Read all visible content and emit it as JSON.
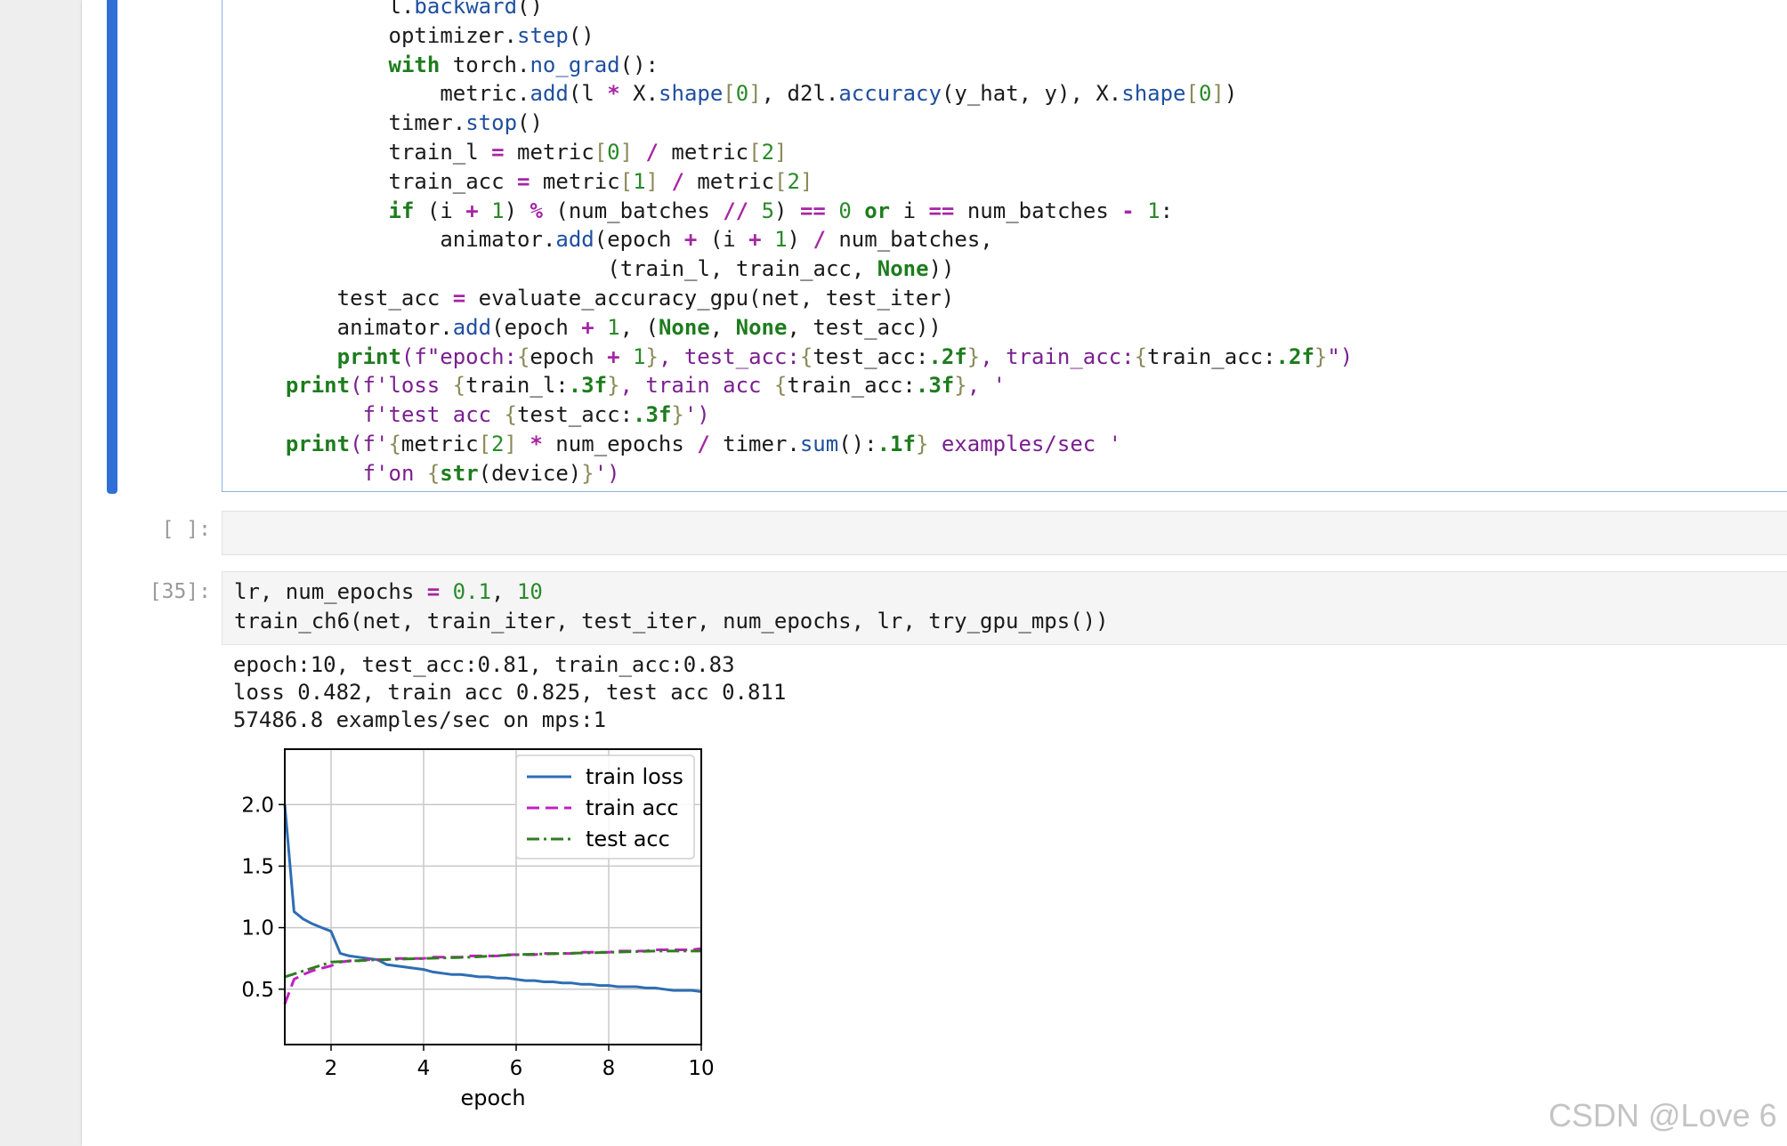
{
  "cell1": {
    "lines": [
      {
        "i": 12,
        "t": [
          [
            "l.",
            "n"
          ],
          [
            "backward",
            "fn"
          ],
          [
            "()",
            "n"
          ]
        ]
      },
      {
        "i": 12,
        "t": [
          [
            "optimizer.",
            "n"
          ],
          [
            "step",
            "fn"
          ],
          [
            "()",
            "n"
          ]
        ]
      },
      {
        "i": 12,
        "t": [
          [
            "with",
            "kw"
          ],
          [
            " torch.",
            "n"
          ],
          [
            "no_grad",
            "fn"
          ],
          [
            "():",
            "n"
          ]
        ]
      },
      {
        "i": 16,
        "t": [
          [
            "metric.",
            "n"
          ],
          [
            "add",
            "fn"
          ],
          [
            "(l ",
            "n"
          ],
          [
            "*",
            "op"
          ],
          [
            " X.",
            "n"
          ],
          [
            "shape",
            "fn"
          ],
          [
            "[",
            "br"
          ],
          [
            "0",
            "nm"
          ],
          [
            "]",
            "br"
          ],
          [
            ", d2l.",
            "n"
          ],
          [
            "accuracy",
            "fn"
          ],
          [
            "(y_hat, y), X.",
            "n"
          ],
          [
            "shape",
            "fn"
          ],
          [
            "[",
            "br"
          ],
          [
            "0",
            "nm"
          ],
          [
            "]",
            "br"
          ],
          [
            ")",
            "n"
          ]
        ]
      },
      {
        "i": 12,
        "t": [
          [
            "timer.",
            "n"
          ],
          [
            "stop",
            "fn"
          ],
          [
            "()",
            "n"
          ]
        ]
      },
      {
        "i": 12,
        "t": [
          [
            "train_l ",
            "n"
          ],
          [
            "=",
            "op"
          ],
          [
            " metric",
            "n"
          ],
          [
            "[",
            "br"
          ],
          [
            "0",
            "nm"
          ],
          [
            "]",
            "br"
          ],
          [
            " ",
            "n"
          ],
          [
            "/",
            "op"
          ],
          [
            " metric",
            "n"
          ],
          [
            "[",
            "br"
          ],
          [
            "2",
            "nm"
          ],
          [
            "]",
            "br"
          ]
        ]
      },
      {
        "i": 12,
        "t": [
          [
            "train_acc ",
            "n"
          ],
          [
            "=",
            "op"
          ],
          [
            " metric",
            "n"
          ],
          [
            "[",
            "br"
          ],
          [
            "1",
            "nm"
          ],
          [
            "]",
            "br"
          ],
          [
            " ",
            "n"
          ],
          [
            "/",
            "op"
          ],
          [
            " metric",
            "n"
          ],
          [
            "[",
            "br"
          ],
          [
            "2",
            "nm"
          ],
          [
            "]",
            "br"
          ]
        ]
      },
      {
        "i": 12,
        "t": [
          [
            "if",
            "kw"
          ],
          [
            " (i ",
            "n"
          ],
          [
            "+",
            "op"
          ],
          [
            " ",
            "n"
          ],
          [
            "1",
            "nm"
          ],
          [
            ") ",
            "n"
          ],
          [
            "%",
            "op"
          ],
          [
            " (num_batches ",
            "n"
          ],
          [
            "//",
            "op"
          ],
          [
            " ",
            "n"
          ],
          [
            "5",
            "nm"
          ],
          [
            ") ",
            "n"
          ],
          [
            "==",
            "op"
          ],
          [
            " ",
            "n"
          ],
          [
            "0",
            "nm"
          ],
          [
            " ",
            "n"
          ],
          [
            "or",
            "kw"
          ],
          [
            " i ",
            "n"
          ],
          [
            "==",
            "op"
          ],
          [
            " num_batches ",
            "n"
          ],
          [
            "-",
            "op"
          ],
          [
            " ",
            "n"
          ],
          [
            "1",
            "nm"
          ],
          [
            ":",
            "n"
          ]
        ]
      },
      {
        "i": 16,
        "t": [
          [
            "animator.",
            "n"
          ],
          [
            "add",
            "fn"
          ],
          [
            "(epoch ",
            "n"
          ],
          [
            "+",
            "op"
          ],
          [
            " (i ",
            "n"
          ],
          [
            "+",
            "op"
          ],
          [
            " ",
            "n"
          ],
          [
            "1",
            "nm"
          ],
          [
            ") ",
            "n"
          ],
          [
            "/",
            "op"
          ],
          [
            " num_batches,",
            "n"
          ]
        ]
      },
      {
        "i": 29,
        "t": [
          [
            "(train_l, train_acc, ",
            "n"
          ],
          [
            "None",
            "kw"
          ],
          [
            "))",
            "n"
          ]
        ]
      },
      {
        "i": 8,
        "t": [
          [
            "test_acc ",
            "n"
          ],
          [
            "=",
            "op"
          ],
          [
            " evaluate_accuracy_gpu(net, test_iter)",
            "n"
          ]
        ]
      },
      {
        "i": 8,
        "t": [
          [
            "animator.",
            "n"
          ],
          [
            "add",
            "fn"
          ],
          [
            "(epoch ",
            "n"
          ],
          [
            "+",
            "op"
          ],
          [
            " ",
            "n"
          ],
          [
            "1",
            "nm"
          ],
          [
            ", (",
            "n"
          ],
          [
            "None",
            "kw"
          ],
          [
            ", ",
            "n"
          ],
          [
            "None",
            "kw"
          ],
          [
            ", test_acc))",
            "n"
          ]
        ]
      },
      {
        "i": 8,
        "t": [
          [
            "print",
            "sp"
          ],
          [
            "(f\"epoch:",
            "st"
          ],
          [
            "{",
            "br"
          ],
          [
            "epoch ",
            "n"
          ],
          [
            "+",
            "op"
          ],
          [
            " ",
            "n"
          ],
          [
            "1",
            "nm"
          ],
          [
            "}",
            "br"
          ],
          [
            ", test_acc:",
            "st"
          ],
          [
            "{",
            "br"
          ],
          [
            "test_acc:",
            "n"
          ],
          [
            ".2f",
            "sp"
          ],
          [
            "}",
            "br"
          ],
          [
            ", train_acc:",
            "st"
          ],
          [
            "{",
            "br"
          ],
          [
            "train_acc:",
            "n"
          ],
          [
            ".2f",
            "sp"
          ],
          [
            "}",
            "br"
          ],
          [
            "\")",
            "st"
          ]
        ]
      },
      {
        "i": 4,
        "t": [
          [
            "print",
            "sp"
          ],
          [
            "(f'loss ",
            "st"
          ],
          [
            "{",
            "br"
          ],
          [
            "train_l:",
            "n"
          ],
          [
            ".3f",
            "sp"
          ],
          [
            "}",
            "br"
          ],
          [
            ", train acc ",
            "st"
          ],
          [
            "{",
            "br"
          ],
          [
            "train_acc:",
            "n"
          ],
          [
            ".3f",
            "sp"
          ],
          [
            "}",
            "br"
          ],
          [
            ", '",
            "st"
          ]
        ]
      },
      {
        "i": 10,
        "t": [
          [
            "f'test acc ",
            "st"
          ],
          [
            "{",
            "br"
          ],
          [
            "test_acc:",
            "n"
          ],
          [
            ".3f",
            "sp"
          ],
          [
            "}",
            "br"
          ],
          [
            "')",
            "st"
          ]
        ]
      },
      {
        "i": 4,
        "t": [
          [
            "print",
            "sp"
          ],
          [
            "(f'",
            "st"
          ],
          [
            "{",
            "br"
          ],
          [
            "metric",
            "n"
          ],
          [
            "[",
            "br"
          ],
          [
            "2",
            "nm"
          ],
          [
            "]",
            "br"
          ],
          [
            " ",
            "n"
          ],
          [
            "*",
            "op"
          ],
          [
            " num_epochs ",
            "n"
          ],
          [
            "/",
            "op"
          ],
          [
            " timer.",
            "n"
          ],
          [
            "sum",
            "fn"
          ],
          [
            "():",
            "n"
          ],
          [
            ".1f",
            "sp"
          ],
          [
            "}",
            "br"
          ],
          [
            " examples/sec '",
            "st"
          ]
        ]
      },
      {
        "i": 10,
        "t": [
          [
            "f'on ",
            "st"
          ],
          [
            "{",
            "br"
          ],
          [
            "str",
            "sp"
          ],
          [
            "(device)",
            "n"
          ],
          [
            "}",
            "br"
          ],
          [
            "')",
            "st"
          ]
        ]
      }
    ]
  },
  "cell2": {
    "prompt": "[ ]:"
  },
  "cell3": {
    "prompt": "[35]:",
    "lines": [
      {
        "i": 0,
        "t": [
          [
            "lr, num_epochs ",
            "n"
          ],
          [
            "=",
            "op"
          ],
          [
            " ",
            "n"
          ],
          [
            "0.1",
            "nm"
          ],
          [
            ", ",
            "n"
          ],
          [
            "10",
            "nm"
          ]
        ]
      },
      {
        "i": 0,
        "t": [
          [
            "train_ch6(net, train_iter, test_iter, num_epochs, lr, try_gpu_mps())",
            "n"
          ]
        ]
      }
    ],
    "output": [
      "epoch:10, test_acc:0.81, train_acc:0.83",
      "loss 0.482, train acc 0.825, test acc 0.811",
      "57486.8 examples/sec on mps:1"
    ]
  },
  "chart_data": {
    "type": "line",
    "xlabel": "epoch",
    "ylabel": "",
    "xlim": [
      1,
      10
    ],
    "ylim": [
      0.05,
      2.45
    ],
    "xticks": [
      "2",
      "4",
      "6",
      "8",
      "10"
    ],
    "yticks": [
      "0.5",
      "1.0",
      "1.5",
      "2.0"
    ],
    "grid": true,
    "legend_position": "top-right",
    "series": [
      {
        "name": "train loss",
        "color": "#2e6db4",
        "style": "solid",
        "x": [
          1.0,
          1.2,
          1.4,
          1.6,
          1.8,
          2.0,
          2.2,
          2.4,
          2.6,
          2.8,
          3.0,
          3.2,
          3.4,
          3.6,
          3.8,
          4.0,
          4.2,
          4.4,
          4.6,
          4.8,
          5.0,
          5.2,
          5.4,
          5.6,
          5.8,
          6.0,
          6.2,
          6.4,
          6.6,
          6.8,
          7.0,
          7.2,
          7.4,
          7.6,
          7.8,
          8.0,
          8.2,
          8.4,
          8.6,
          8.8,
          9.0,
          9.2,
          9.4,
          9.6,
          9.8,
          10.0
        ],
        "y": [
          2.0,
          1.13,
          1.07,
          1.03,
          1.0,
          0.97,
          0.79,
          0.77,
          0.76,
          0.75,
          0.74,
          0.7,
          0.69,
          0.68,
          0.67,
          0.66,
          0.64,
          0.63,
          0.62,
          0.62,
          0.61,
          0.6,
          0.6,
          0.59,
          0.59,
          0.58,
          0.57,
          0.57,
          0.56,
          0.56,
          0.55,
          0.55,
          0.54,
          0.54,
          0.53,
          0.53,
          0.52,
          0.52,
          0.52,
          0.51,
          0.51,
          0.5,
          0.49,
          0.49,
          0.49,
          0.48
        ]
      },
      {
        "name": "train acc",
        "color": "#c21fc2",
        "style": "dashed",
        "x": [
          1.0,
          1.2,
          1.4,
          1.6,
          1.8,
          2.0,
          2.2,
          2.4,
          2.6,
          2.8,
          3.0,
          3.2,
          3.4,
          3.6,
          3.8,
          4.0,
          4.2,
          4.4,
          4.6,
          4.8,
          5.0,
          5.2,
          5.4,
          5.6,
          5.8,
          6.0,
          6.2,
          6.4,
          6.6,
          6.8,
          7.0,
          7.2,
          7.4,
          7.6,
          7.8,
          8.0,
          8.2,
          8.4,
          8.6,
          8.8,
          9.0,
          9.2,
          9.4,
          9.6,
          9.8,
          10.0
        ],
        "y": [
          0.38,
          0.58,
          0.62,
          0.65,
          0.67,
          0.69,
          0.72,
          0.73,
          0.73,
          0.74,
          0.74,
          0.74,
          0.75,
          0.75,
          0.75,
          0.75,
          0.76,
          0.76,
          0.76,
          0.76,
          0.77,
          0.77,
          0.77,
          0.77,
          0.78,
          0.78,
          0.78,
          0.78,
          0.79,
          0.79,
          0.79,
          0.79,
          0.8,
          0.8,
          0.8,
          0.8,
          0.81,
          0.81,
          0.81,
          0.81,
          0.82,
          0.82,
          0.82,
          0.82,
          0.82,
          0.83
        ]
      },
      {
        "name": "test acc",
        "color": "#2f7d1f",
        "style": "dashdot",
        "x": [
          1.0,
          2.0,
          3.0,
          4.0,
          5.0,
          6.0,
          7.0,
          8.0,
          9.0,
          10.0
        ],
        "y": [
          0.6,
          0.72,
          0.74,
          0.75,
          0.76,
          0.78,
          0.79,
          0.8,
          0.81,
          0.81
        ]
      }
    ]
  },
  "watermark": "CSDN @Love 6"
}
